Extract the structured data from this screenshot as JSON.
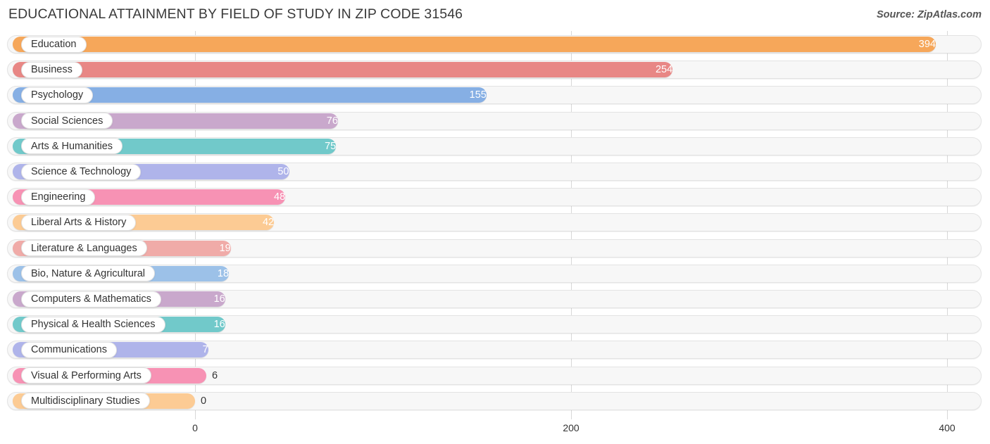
{
  "header": {
    "title": "EDUCATIONAL ATTAINMENT BY FIELD OF STUDY IN ZIP CODE 31546",
    "source": "Source: ZipAtlas.com"
  },
  "chart_data": {
    "type": "bar",
    "orientation": "horizontal",
    "title": "EDUCATIONAL ATTAINMENT BY FIELD OF STUDY IN ZIP CODE 31546",
    "xlabel": "",
    "ylabel": "",
    "xlim": [
      0,
      400
    ],
    "ticks": [
      0,
      200,
      400
    ],
    "tick_labels": [
      "0",
      "200",
      "400"
    ],
    "grid": true,
    "legend": false,
    "categories": [
      "Education",
      "Business",
      "Psychology",
      "Social Sciences",
      "Arts & Humanities",
      "Science & Technology",
      "Engineering",
      "Liberal Arts & History",
      "Literature & Languages",
      "Bio, Nature & Agricultural",
      "Computers & Mathematics",
      "Physical & Health Sciences",
      "Communications",
      "Visual & Performing Arts",
      "Multidisciplinary Studies"
    ],
    "values": [
      394,
      254,
      155,
      76,
      75,
      50,
      48,
      42,
      19,
      18,
      16,
      16,
      7,
      6,
      0
    ],
    "value_labels": [
      "394",
      "254",
      "155",
      "76",
      "75",
      "50",
      "48",
      "42",
      "19",
      "18",
      "16",
      "16",
      "7",
      "6",
      "0"
    ],
    "colors": [
      "#f6a75a",
      "#e88785",
      "#86afe4",
      "#c9a8cc",
      "#71c9ca",
      "#afb4ea",
      "#f792b4",
      "#fccb94",
      "#f0aba8",
      "#9cc1e8",
      "#c9a8cc",
      "#71c9ca",
      "#afb4ea",
      "#f792b4",
      "#fccb94"
    ]
  }
}
